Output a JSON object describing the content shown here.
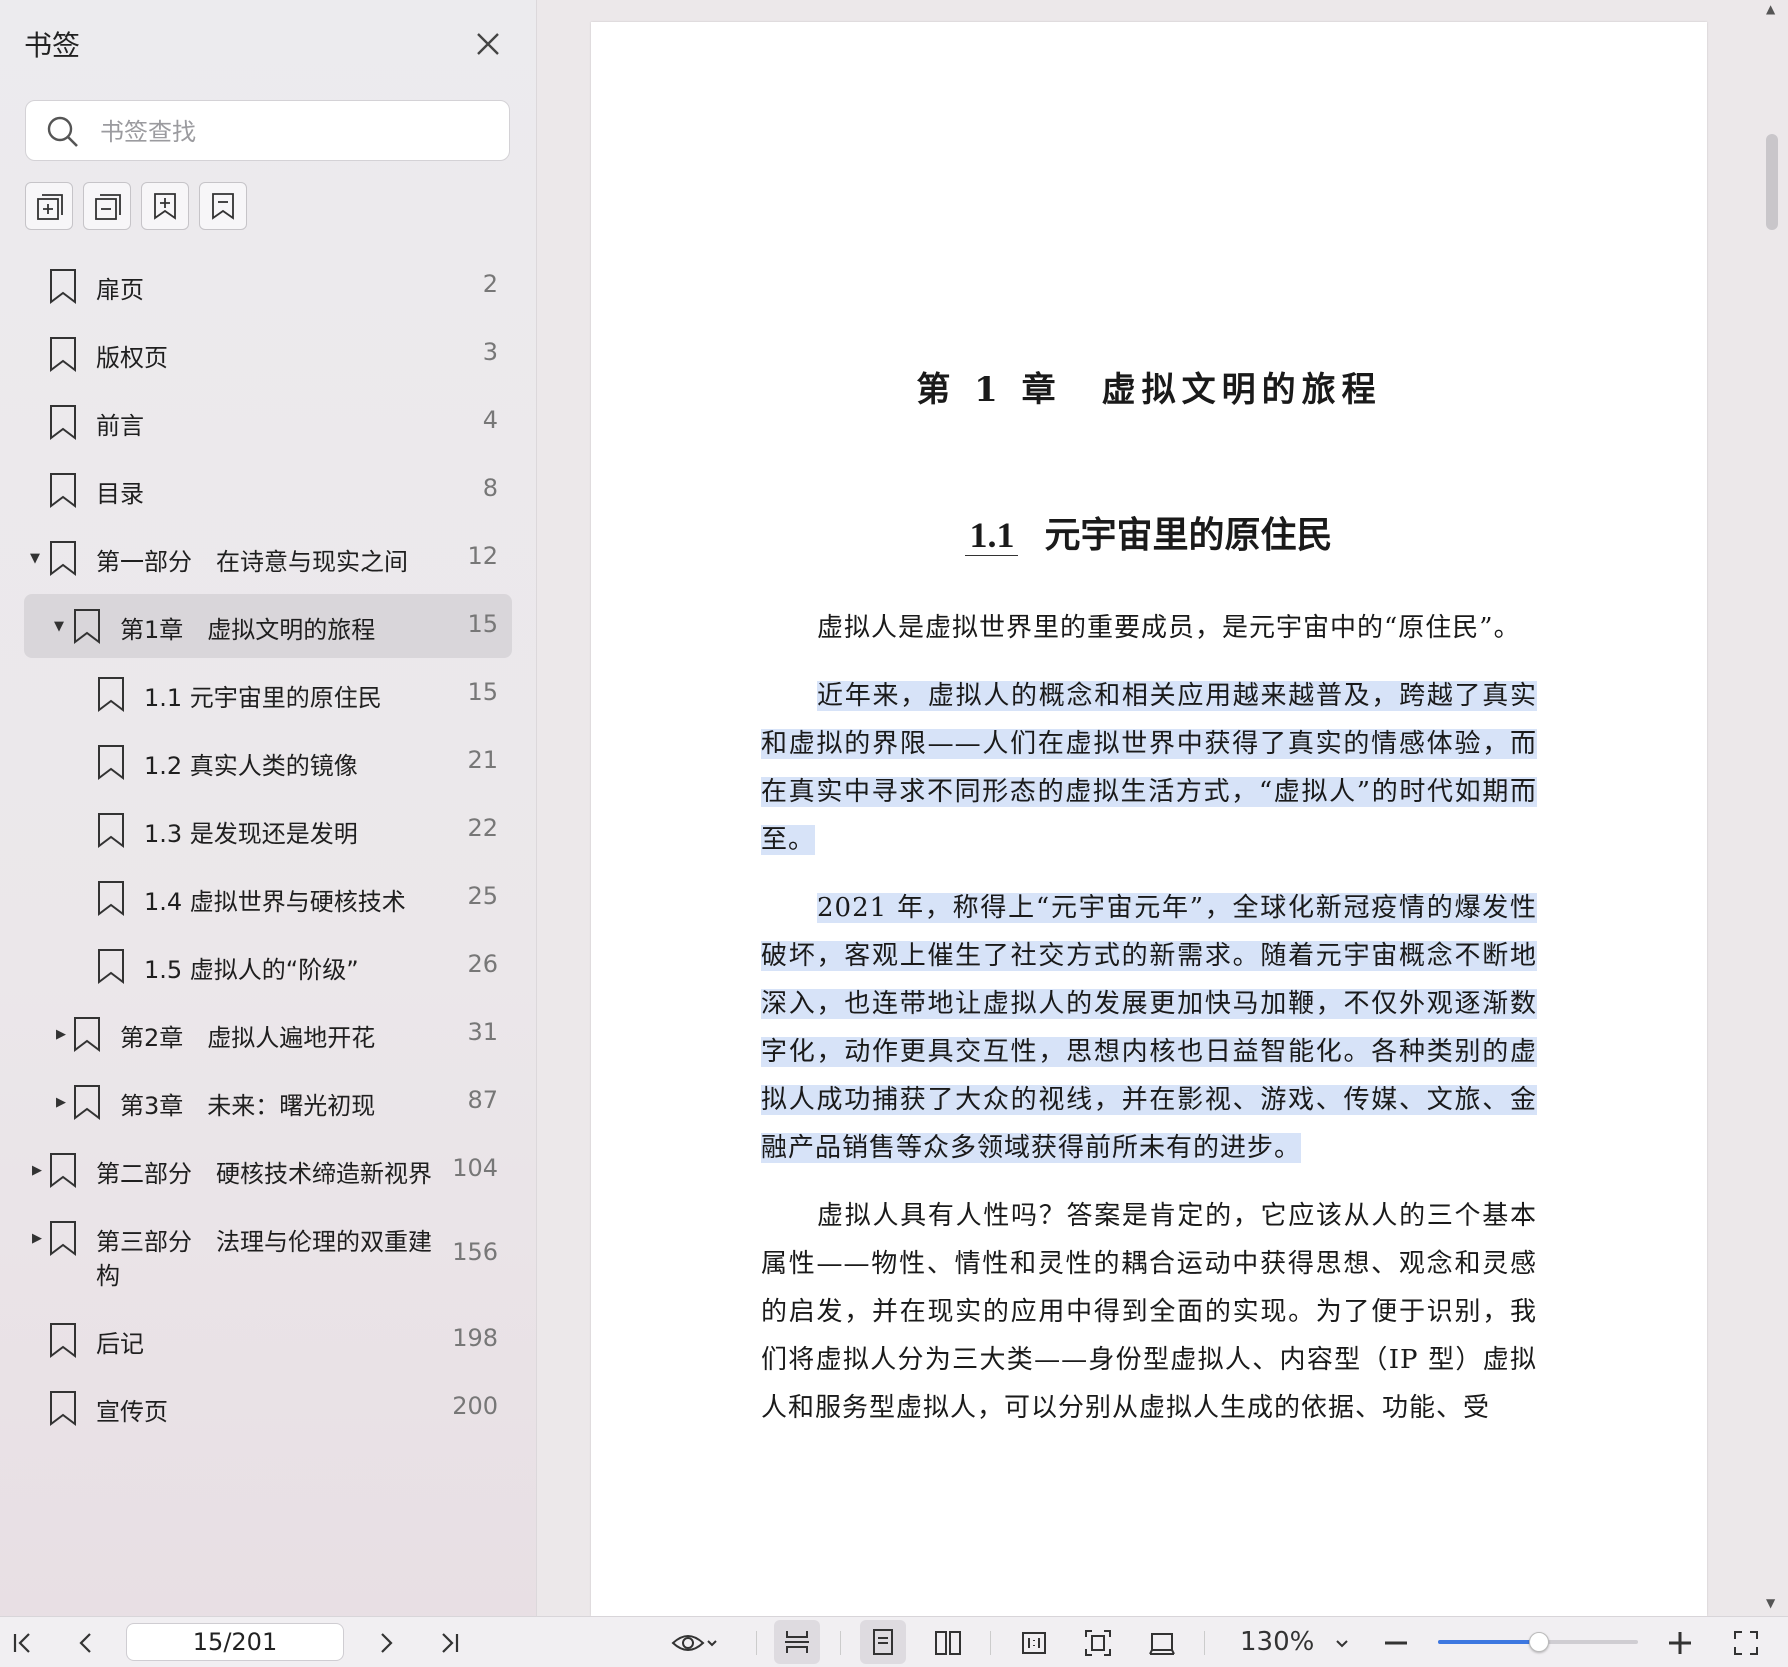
{
  "sidebar": {
    "title": "书签",
    "search_placeholder": "书签查找",
    "bookmarks": [
      {
        "label": "扉页",
        "page": "2"
      },
      {
        "label": "版权页",
        "page": "3"
      },
      {
        "label": "前言",
        "page": "4"
      },
      {
        "label": "目录",
        "page": "8"
      },
      {
        "label": "第一部分　在诗意与现实之间",
        "page": "12",
        "expanded": true
      },
      {
        "label": "第1章　虚拟文明的旅程",
        "page": "15",
        "expanded": true,
        "active": true
      },
      {
        "label": "1.1  元宇宙里的原住民",
        "page": "15"
      },
      {
        "label": "1.2  真实人类的镜像",
        "page": "21"
      },
      {
        "label": "1.3  是发现还是发明",
        "page": "22"
      },
      {
        "label": "1.4  虚拟世界与硬核技术",
        "page": "25"
      },
      {
        "label": "1.5  虚拟人的“阶级”",
        "page": "26"
      },
      {
        "label": "第2章　虚拟人遍地开花",
        "page": "31",
        "expanded": false
      },
      {
        "label": "第3章　未来：曙光初现",
        "page": "87",
        "expanded": false
      },
      {
        "label": "第二部分　硬核技术缔造新视界",
        "page": "104",
        "expanded": false
      },
      {
        "label": "第三部分　法理与伦理的双重建",
        "label_cont": "构",
        "page": "156",
        "expanded": false
      },
      {
        "label": "后记",
        "page": "198"
      },
      {
        "label": "宣传页",
        "page": "200"
      }
    ]
  },
  "document": {
    "chapter_title": "第 1 章　虚拟文明的旅程",
    "section_number": "1.1",
    "section_title": "元宇宙里的原住民",
    "paragraphs": [
      "虚拟人是虚拟世界里的重要成员，是元宇宙中的“原住民”。",
      "近年来，虚拟人的概念和相关应用越来越普及，跨越了真实和虚拟的界限——人们在虚拟世界中获得了真实的情感体验，而在真实中寻求不同形态的虚拟生活方式，“虚拟人”的时代如期而至。",
      "2021 年，称得上“元宇宙元年”，全球化新冠疫情的爆发性破坏，客观上催生了社交方式的新需求。随着元宇宙概念不断地深入，也连带地让虚拟人的发展更加快马加鞭，不仅外观逐渐数字化，动作更具交互性，思想内核也日益智能化。各种类别的虚拟人成功捕获了大众的视线，并在影视、游戏、传媒、文旅、金融产品销售等众多领域获得前所未有的进步。",
      "虚拟人具有人性吗？答案是肯定的，它应该从人的三个基本属性——物性、情性和灵性的耦合运动中获得思想、观念和灵感的启发，并在现实的应用中得到全面的实现。为了便于识别，我们将虚拟人分为三大类——身份型虚拟人、内容型（IP 型）虚拟人和服务型虚拟人，可以分别从虚拟人生成的依据、功能、受"
    ]
  },
  "toolbar": {
    "page_indicator": "15/201",
    "zoom_level": "130%",
    "zoom_fraction": 0.5
  },
  "colors": {
    "highlight": "#d7e3f8",
    "accent": "#3d77e0",
    "active_row": "#d9d6da"
  }
}
